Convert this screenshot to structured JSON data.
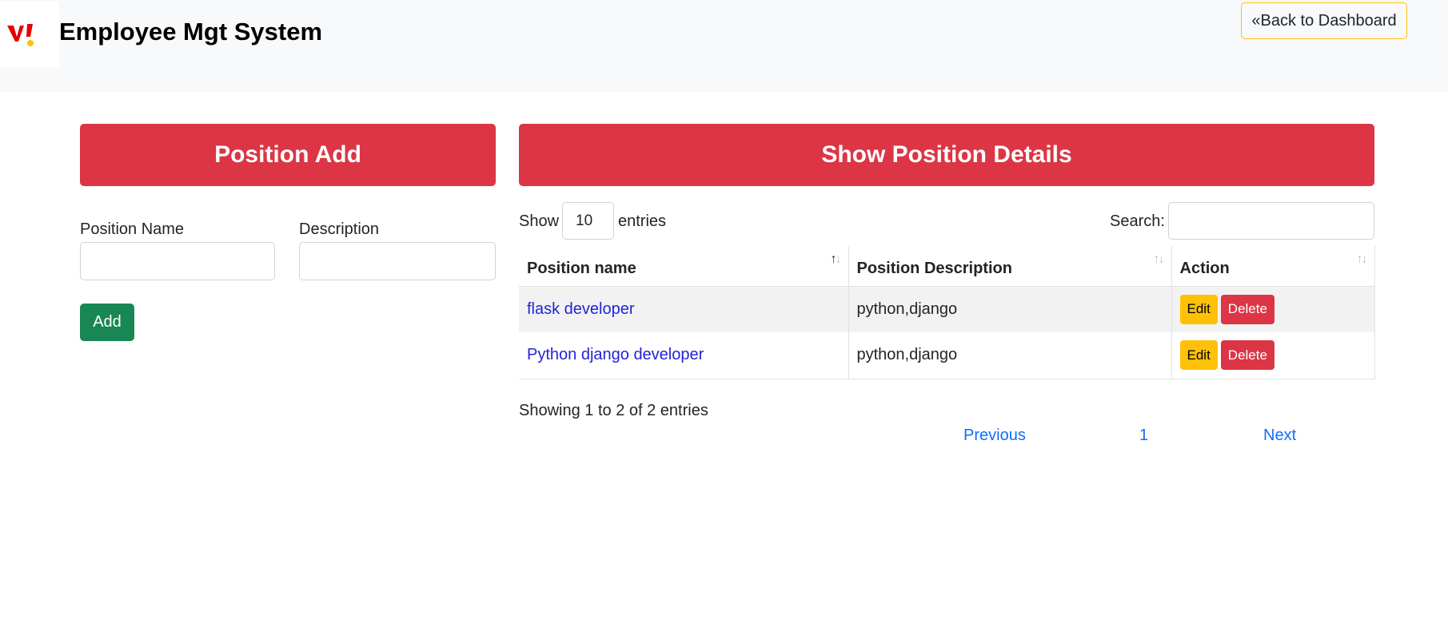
{
  "navbar": {
    "brand": "Employee Mgt System",
    "back_button": "«Back to Dashboard",
    "colors": {
      "logo_red": "#e60000",
      "logo_yellow": "#ffc107"
    }
  },
  "form": {
    "title": "Position Add",
    "position_name_label": "Position Name",
    "position_name_value": "",
    "description_label": "Description",
    "description_value": "",
    "add_button": "Add"
  },
  "details": {
    "title": "Show Position Details",
    "show_label": "Show",
    "entries_label": "entries",
    "page_length": "10",
    "search_label": "Search:",
    "search_value": "",
    "columns": [
      "Position name",
      "Position Description",
      "Action"
    ],
    "rows": [
      {
        "name": "flask developer",
        "description": "python,django",
        "edit": "Edit",
        "delete": "Delete"
      },
      {
        "name": "Python django developer",
        "description": "python,django",
        "edit": "Edit",
        "delete": "Delete"
      }
    ],
    "info": "Showing 1 to 2 of 2 entries",
    "pagination": {
      "previous": "Previous",
      "current": "1",
      "next": "Next"
    }
  }
}
